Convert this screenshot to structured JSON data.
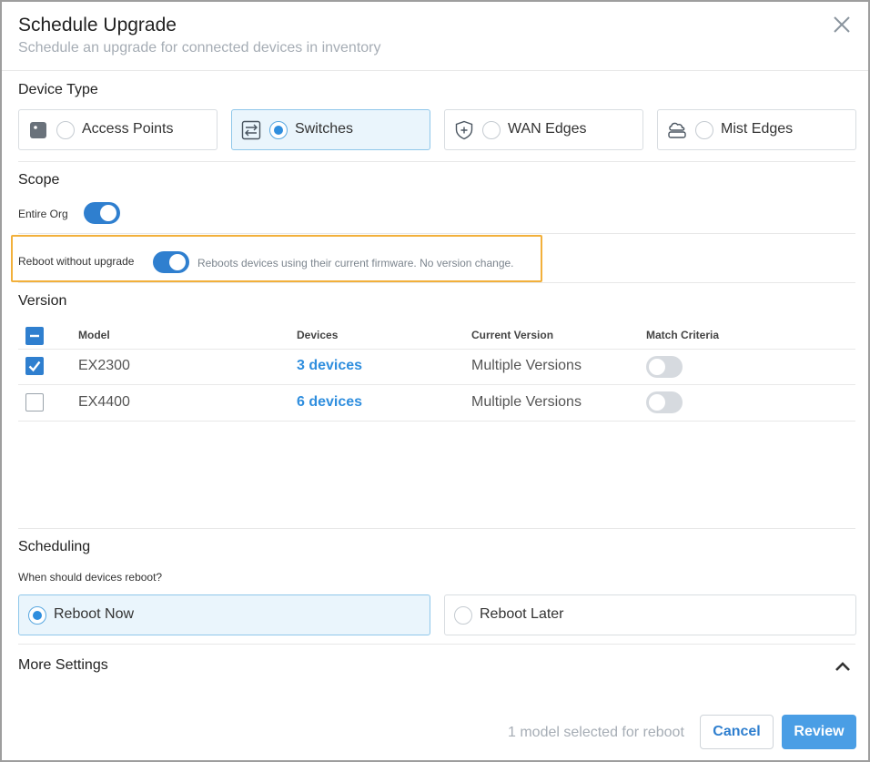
{
  "header": {
    "title": "Schedule Upgrade",
    "subtitle": "Schedule an upgrade for connected devices in inventory"
  },
  "device_type": {
    "title": "Device Type",
    "options": [
      {
        "label": "Access Points",
        "icon": "access-point-icon",
        "selected": false
      },
      {
        "label": "Switches",
        "icon": "switch-icon",
        "selected": true
      },
      {
        "label": "WAN Edges",
        "icon": "wan-edge-shield-icon",
        "selected": false
      },
      {
        "label": "Mist Edges",
        "icon": "mist-edge-cloud-icon",
        "selected": false
      }
    ]
  },
  "scope": {
    "title": "Scope",
    "entire_org_label": "Entire Org",
    "entire_org_on": true,
    "reboot_label": "Reboot without upgrade",
    "reboot_on": true,
    "reboot_desc": "Reboots devices using their current firmware. No version change."
  },
  "version": {
    "title": "Version",
    "headers": {
      "model": "Model",
      "devices": "Devices",
      "current": "Current Version",
      "match": "Match Criteria"
    },
    "rows": [
      {
        "model": "EX2300",
        "devices": "3 devices",
        "current": "Multiple Versions",
        "checked": true,
        "match_on": false
      },
      {
        "model": "EX4400",
        "devices": "6 devices",
        "current": "Multiple Versions",
        "checked": false,
        "match_on": false
      }
    ]
  },
  "scheduling": {
    "title": "Scheduling",
    "question": "When should devices reboot?",
    "options": [
      {
        "label": "Reboot Now",
        "selected": true
      },
      {
        "label": "Reboot Later",
        "selected": false
      }
    ]
  },
  "more_settings": {
    "title": "More Settings",
    "expanded": true
  },
  "footer": {
    "note": "1 model selected for reboot",
    "cancel": "Cancel",
    "review": "Review"
  },
  "colors": {
    "accent": "#2f7fcf",
    "selected_bg": "#eaf5fc",
    "highlight": "#f2b03b",
    "link": "#2f8ede"
  }
}
